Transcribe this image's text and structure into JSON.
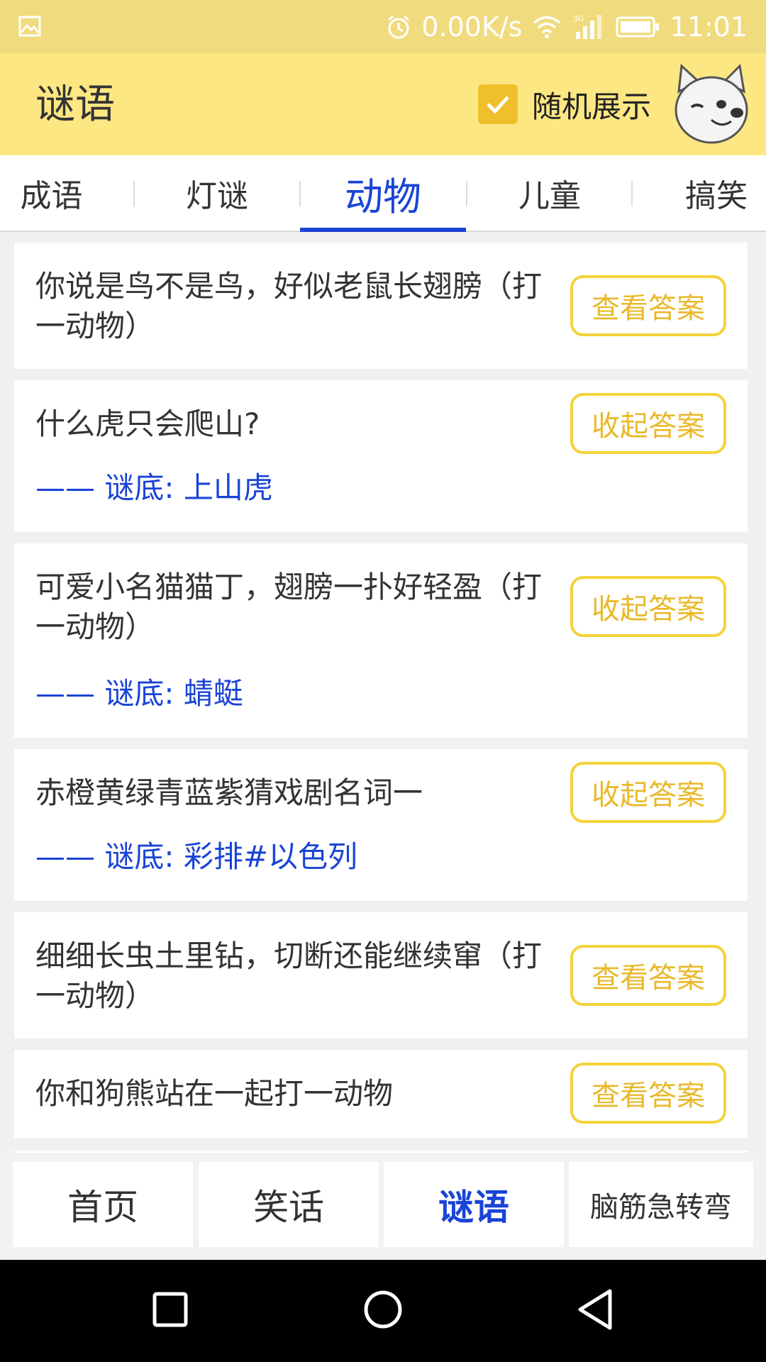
{
  "status_bar": {
    "speed": "0.00K/s",
    "network": "3G",
    "time": "11:01"
  },
  "app_bar": {
    "title": "谜语",
    "random_label": "随机展示",
    "random_checked": true
  },
  "category_tabs": [
    {
      "label": "成语",
      "active": false
    },
    {
      "label": "灯谜",
      "active": false
    },
    {
      "label": "动物",
      "active": true
    },
    {
      "label": "儿童",
      "active": false
    },
    {
      "label": "搞笑",
      "active": false
    }
  ],
  "riddles": [
    {
      "question": "你说是鸟不是鸟，好似老鼠长翅膀（打一动物）",
      "button": "查看答案",
      "answer": null
    },
    {
      "question": "什么虎只会爬山?",
      "button": "收起答案",
      "answer": "—— 谜底: 上山虎"
    },
    {
      "question": "可爱小名猫猫丁，翅膀一扑好轻盈（打一动物）",
      "button": "收起答案",
      "answer": "—— 谜底: 蜻蜓"
    },
    {
      "question": "赤橙黄绿青蓝紫猜戏剧名词一",
      "button": "收起答案",
      "answer": "—— 谜底: 彩排#以色列"
    },
    {
      "question": "细细长虫土里钻，切断还能继续窜（打一动物）",
      "button": "查看答案",
      "answer": null
    },
    {
      "question": "你和狗熊站在一起打一动物",
      "button": "查看答案",
      "answer": null
    }
  ],
  "bottom_nav": [
    {
      "label": "首页",
      "active": false
    },
    {
      "label": "笑话",
      "active": false
    },
    {
      "label": "谜语",
      "active": true
    },
    {
      "label": "脑筋急转弯",
      "active": false
    }
  ],
  "colors": {
    "status_bar": "#f0db7e",
    "app_bar": "#fde783",
    "accent_blue": "#1a44d6",
    "button_border": "#f5d23b",
    "button_text": "#e9b92a",
    "checkbox": "#efc02c"
  },
  "icons": {
    "gallery": "gallery-icon",
    "alarm": "alarm-icon",
    "wifi": "wifi-icon",
    "signal": "signal-icon",
    "battery": "battery-icon",
    "checkmark": "checkmark-icon",
    "avatar": "dog-avatar-icon",
    "recent_apps": "square-icon",
    "home": "circle-icon",
    "back": "triangle-back-icon"
  }
}
